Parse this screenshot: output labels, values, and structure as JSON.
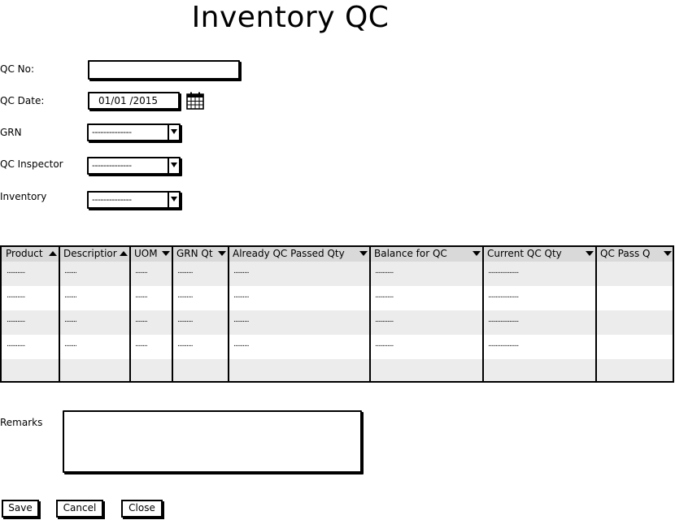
{
  "page": {
    "title": "Inventory QC"
  },
  "form": {
    "qc_no": {
      "label": "QC No:",
      "value": ""
    },
    "qc_date": {
      "label": "QC Date:",
      "value": "01/01 /2015"
    },
    "grn": {
      "label": "GRN",
      "value": "--------------"
    },
    "qc_inspector": {
      "label": "QC Inspector",
      "value": "--------------"
    },
    "inventory": {
      "label": "Inventory",
      "value": "--------------"
    }
  },
  "grid": {
    "columns": [
      {
        "label": "Product",
        "sort": "asc"
      },
      {
        "label": "Descriptior",
        "sort": "asc"
      },
      {
        "label": "UOM",
        "sort": "desc"
      },
      {
        "label": "GRN Qt",
        "sort": "desc"
      },
      {
        "label": "Already QC Passed Qty",
        "sort": "desc"
      },
      {
        "label": "Balance for QC",
        "sort": "desc"
      },
      {
        "label": "Current QC Qty",
        "sort": "desc"
      },
      {
        "label": "QC Pass Q",
        "sort": "desc"
      }
    ],
    "rows": [
      [
        "............",
        "........",
        "........",
        "..........",
        "..........",
        "............",
        "....................",
        ""
      ],
      [
        "............",
        "........",
        "........",
        "..........",
        "..........",
        "............",
        "....................",
        ""
      ],
      [
        "............",
        "........",
        "........",
        "..........",
        "..........",
        "............",
        "....................",
        ""
      ],
      [
        "............",
        "........",
        "........",
        "..........",
        "..........",
        "............",
        "....................",
        ""
      ],
      [
        "",
        "",
        "",
        "",
        "",
        "",
        "",
        ""
      ]
    ]
  },
  "remarks": {
    "label": "Remarks",
    "value": ""
  },
  "buttons": {
    "save": "Save",
    "cancel": "Cancel",
    "close": "Close"
  },
  "icons": {
    "calendar": "calendar-icon",
    "dropdown": "chevron-down-icon",
    "sort_asc": "sort-up-icon",
    "sort_desc": "sort-down-icon"
  }
}
